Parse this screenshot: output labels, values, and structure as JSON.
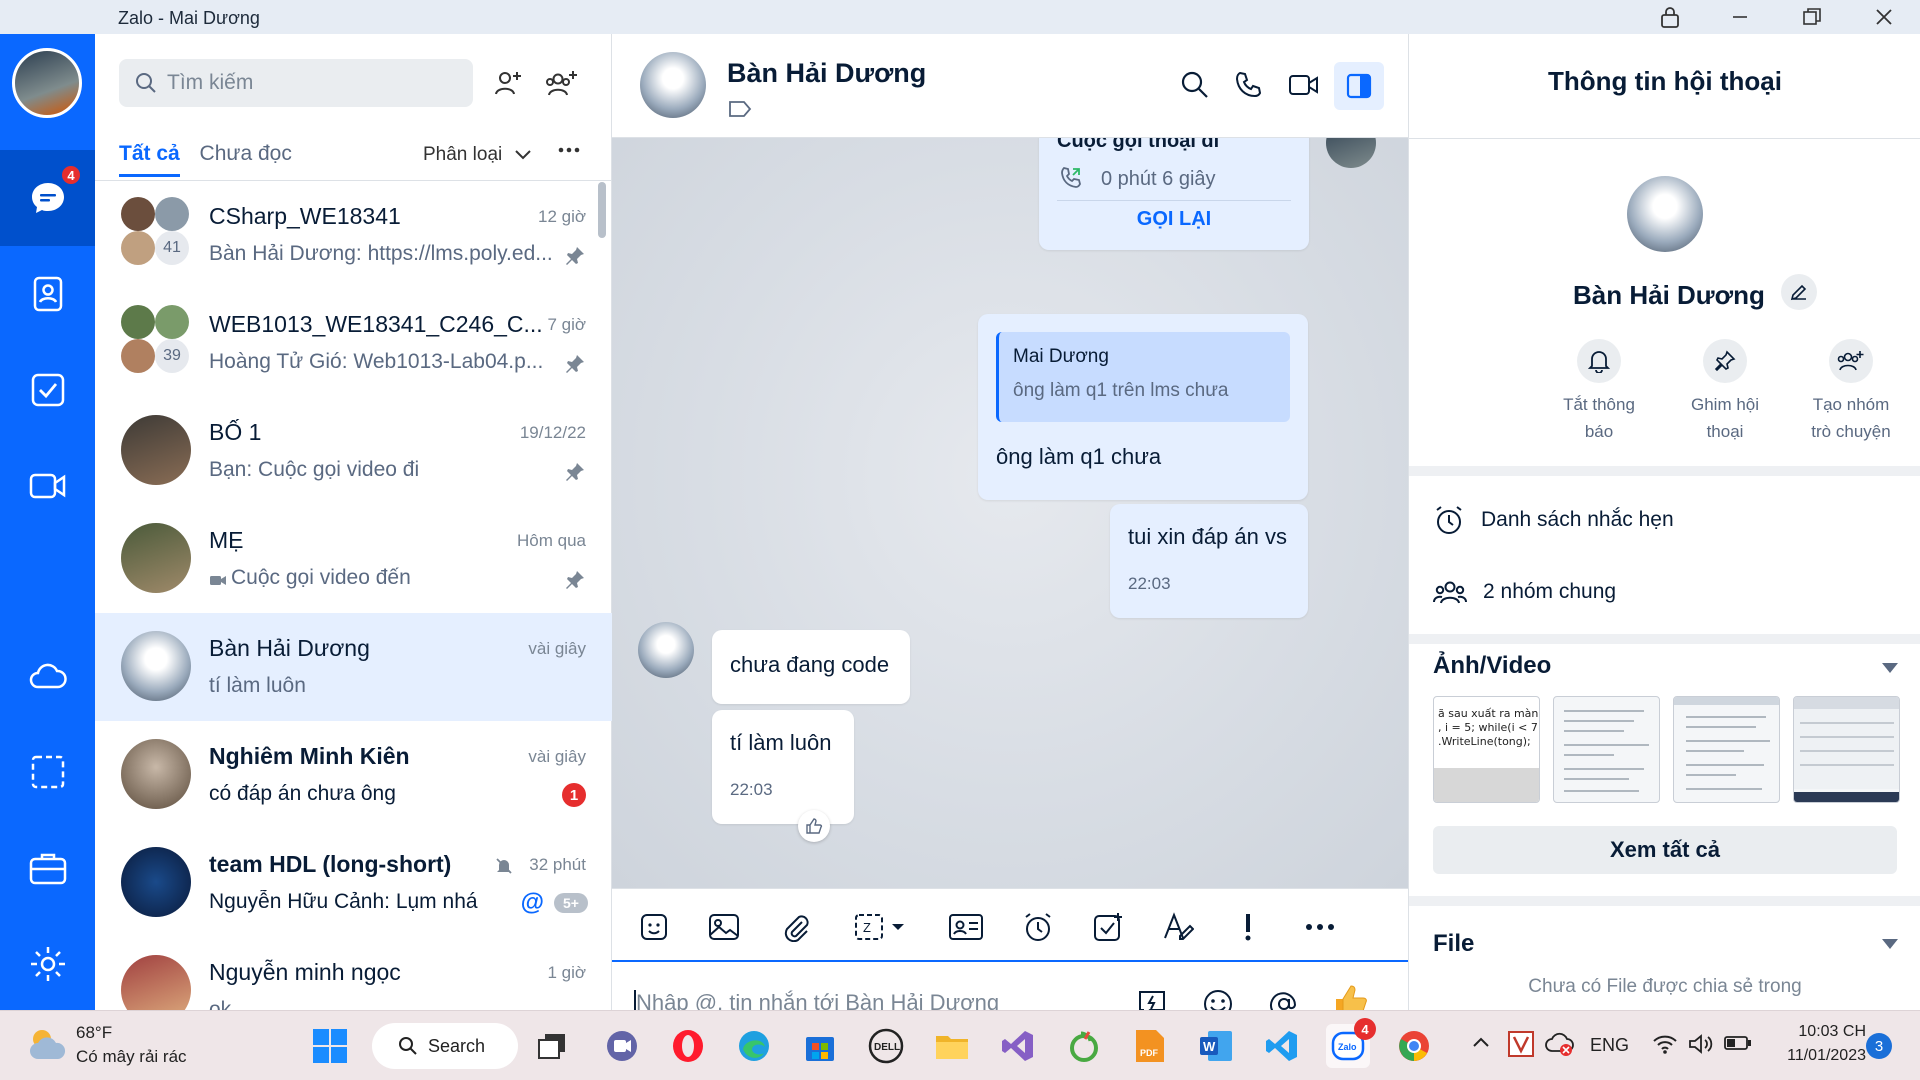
{
  "window": {
    "title": "Zalo - Mai Dương"
  },
  "rail": {
    "messages_badge": "4"
  },
  "list": {
    "search_placeholder": "Tìm kiếm",
    "tabs": {
      "all": "Tất cả",
      "unread": "Chưa đọc",
      "classify": "Phân loại"
    },
    "conversations": [
      {
        "name": "CSharp_WE18341",
        "time": "12 giờ",
        "preview": "Bàn Hải Dương: https://lms.poly.ed...",
        "member_count": "41"
      },
      {
        "name": "WEB1013_WE18341_C246_C...",
        "time": "7 giờ",
        "preview": "Hoàng Tử Gió:  Web1013-Lab04.p...",
        "member_count": "39"
      },
      {
        "name": "BỐ 1",
        "time": "19/12/22",
        "preview": "Bạn:  Cuộc gọi video đi"
      },
      {
        "name": "MẸ",
        "time": "Hôm qua",
        "preview": "Cuộc gọi video đến"
      },
      {
        "name": "Bàn Hải Dương",
        "time": "vài giây",
        "preview": "tí làm luôn"
      },
      {
        "name": "Nghiêm Minh Kiên",
        "time": "vài giây",
        "preview": "có đáp án chưa ông",
        "unread": "1"
      },
      {
        "name": "team HDL (long-short)",
        "time": "32 phút",
        "preview": "Nguyễn Hữu Cảnh: Lụm nhá",
        "more_badge": "5+"
      },
      {
        "name": "Nguyễn minh ngọc",
        "time": "1 giờ",
        "preview": "ok"
      }
    ]
  },
  "chat": {
    "contact_name": "Bàn Hải Dương",
    "messages": {
      "call_title": "Cuộc gọi thoại đi",
      "call_duration": "0 phút 6 giây",
      "call_back": "GỌI LẠI",
      "quote_author": "Mai Dương",
      "quote_text": "ông làm q1 trên lms chưa",
      "reply_text": "ông làm q1 chưa",
      "msg_out": "tui xin đáp án vs",
      "msg_out_time": "22:03",
      "msg_in_1": "chưa đang code",
      "msg_in_2": "tí làm luôn",
      "msg_in_2_time": "22:03"
    },
    "composer_placeholder": "Nhập @, tin nhắn tới Bàn Hải Dương"
  },
  "info": {
    "title": "Thông tin hội thoại",
    "name": "Bàn Hải Dương",
    "actions": [
      {
        "line1": "Tắt thông",
        "line2": "báo"
      },
      {
        "line1": "Ghim hội",
        "line2": "thoại"
      },
      {
        "line1": "Tạo nhóm",
        "line2": "trò chuyện"
      }
    ],
    "reminders": "Danh sách nhắc hẹn",
    "common_groups": "2 nhóm chung",
    "media_title": "Ảnh/Video",
    "thumb1_text": "ã sau xuất ra màn\n, i = 5; while(i < 7\n.WriteLine(tong);",
    "view_all": "Xem tất cả",
    "file_title": "File",
    "file_empty": "Chưa có File được chia sẻ trong"
  },
  "taskbar": {
    "weather_temp": "68°F",
    "weather_desc": "Có mây rải rác",
    "search": "Search",
    "zalo_badge": "4",
    "lang": "ENG",
    "time": "10:03 CH",
    "date": "11/01/2023",
    "notif_count": "3"
  }
}
